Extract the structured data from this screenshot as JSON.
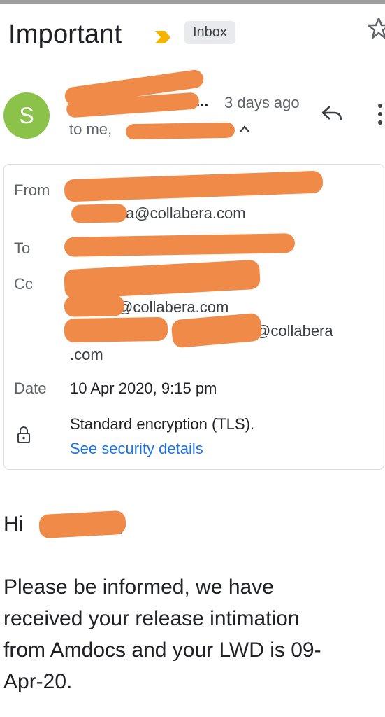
{
  "header": {
    "subject": "Important",
    "label": "Inbox"
  },
  "message": {
    "avatar_initial": "S",
    "sender_suffix": "...",
    "time": "3 days ago",
    "to_prefix": "to me,"
  },
  "details": {
    "from_label": "From",
    "from_email_domain": "a@collabera.com",
    "to_label": "To",
    "cc_label": "Cc",
    "cc_line2_domain": "@collabera.com",
    "cc_line3_domain": "@collabera",
    "cc_line4": ".com",
    "date_label": "Date",
    "date_value": "10 Apr 2020, 9:15 pm",
    "encryption": "Standard encryption (TLS).",
    "security_link": "See security details"
  },
  "body": {
    "greeting": "Hi",
    "comma": ",",
    "line1": "Please be informed, we have",
    "line2": "received your release intimation",
    "line3": "from Amdocs and your LWD is 09-",
    "line4": "Apr-20."
  }
}
